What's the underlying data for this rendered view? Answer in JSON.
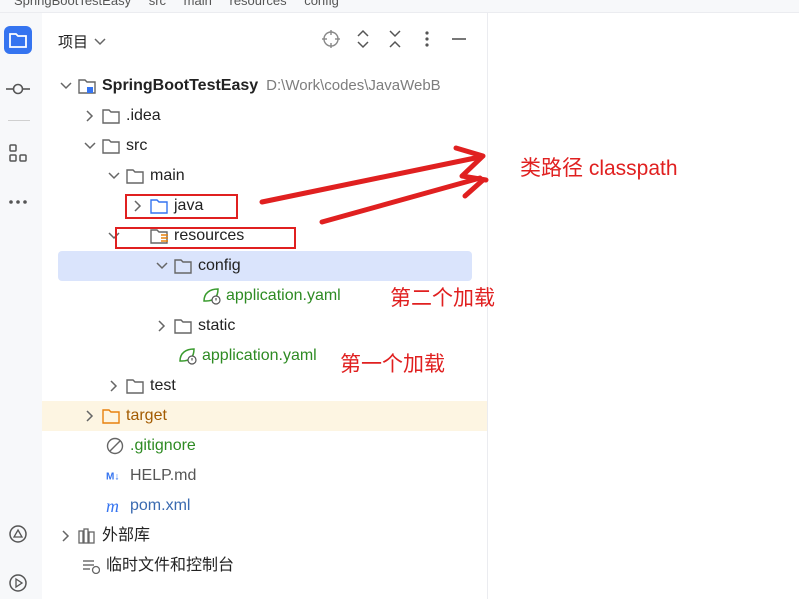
{
  "breadcrumb": [
    "SpringBootTestEasy",
    "src",
    "main",
    "resources",
    "config"
  ],
  "panel": {
    "title": "项目"
  },
  "tree": {
    "project": {
      "name": "SpringBootTestEasy",
      "path": "D:\\Work\\codes\\JavaWebB"
    },
    "idea": ".idea",
    "src": "src",
    "main": "main",
    "java": "java",
    "resources": "resources",
    "config": "config",
    "config_yaml": "application.yaml",
    "static": "static",
    "res_yaml": "application.yaml",
    "test": "test",
    "target": "target",
    "gitignore": ".gitignore",
    "help": "HELP.md",
    "pom": "pom.xml",
    "ext_libs": "外部库",
    "scratches": "临时文件和控制台"
  },
  "annotations": {
    "classpath": "类路径 classpath",
    "second_load": "第二个加载",
    "first_load": "第一个加载"
  },
  "colors": {
    "accent": "#3574f0",
    "annotation": "#e02020",
    "selected_row": "#dae4fc",
    "excluded_row": "#fdf5e2",
    "yaml_text": "#2e8b23"
  }
}
